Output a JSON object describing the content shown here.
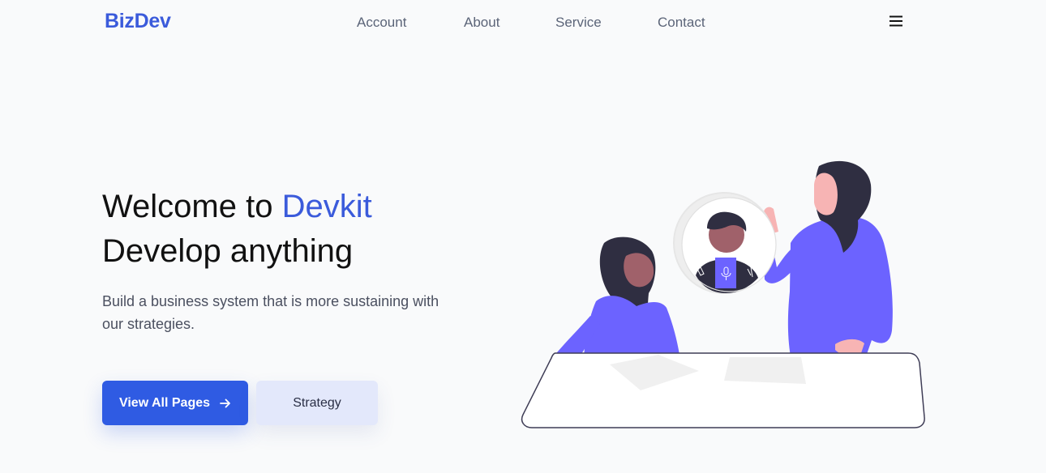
{
  "header": {
    "logo": "BizDev",
    "nav": [
      "Account",
      "About",
      "Service",
      "Contact"
    ],
    "menu_icon": "hamburger-menu-icon"
  },
  "hero": {
    "title_line1_prefix": "Welcome to ",
    "title_line1_accent": "Devkit",
    "title_line2": "Develop anything",
    "subtitle": "Build a business system that is more sustaining with our strategies.",
    "primary_button": "View All Pages",
    "primary_button_icon": "arrow-right-icon",
    "secondary_button": "Strategy"
  },
  "illustration": {
    "name": "team-video-call-illustration"
  },
  "colors": {
    "brand": "#3b5bdb",
    "primary_button": "#2f5be3",
    "secondary_button": "#e3e8fb",
    "illustration_accent": "#6c63ff",
    "background": "#f9fafb"
  }
}
